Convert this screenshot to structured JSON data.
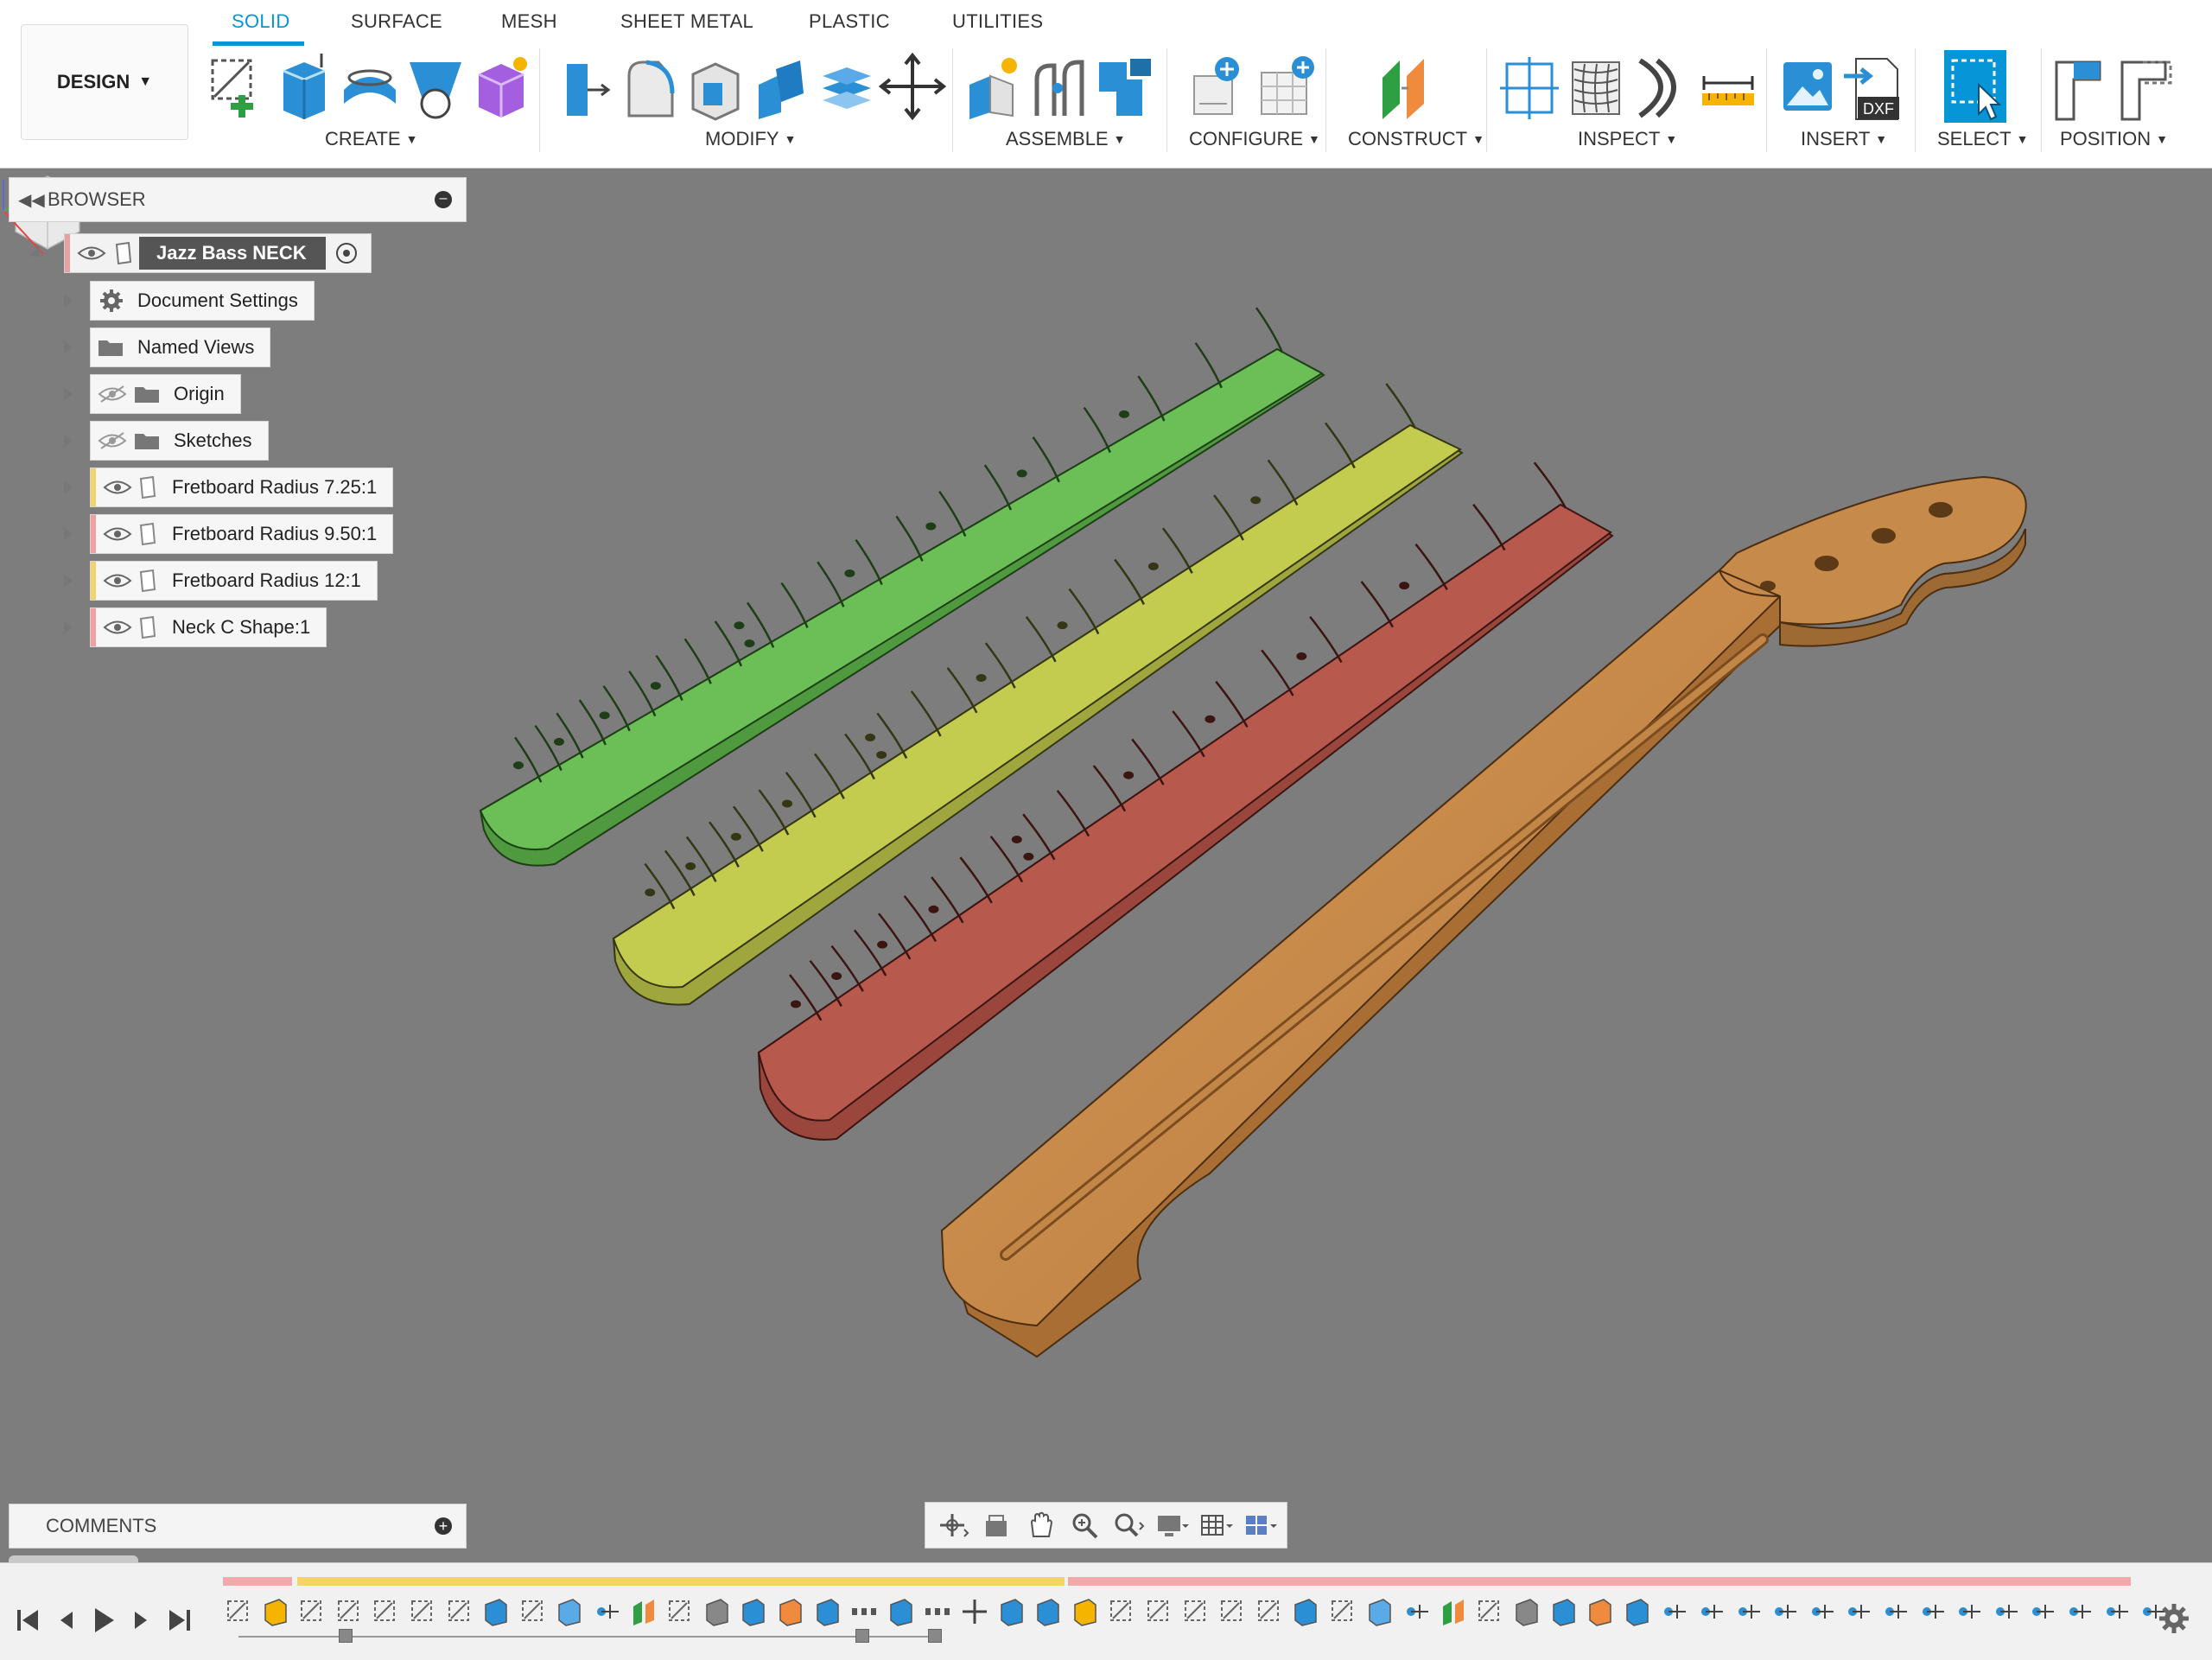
{
  "workspace": {
    "label": "DESIGN"
  },
  "tabs": [
    {
      "label": "SOLID",
      "active": true
    },
    {
      "label": "SURFACE"
    },
    {
      "label": "MESH"
    },
    {
      "label": "SHEET METAL"
    },
    {
      "label": "PLASTIC"
    },
    {
      "label": "UTILITIES"
    }
  ],
  "groups": {
    "create": "CREATE",
    "modify": "MODIFY",
    "assemble": "ASSEMBLE",
    "configure": "CONFIGURE",
    "construct": "CONSTRUCT",
    "inspect": "INSPECT",
    "insert": "INSERT",
    "select": "SELECT",
    "position": "POSITION"
  },
  "toolbar_icons": {
    "insert_dxf_badge": "DXF"
  },
  "browser": {
    "title": "BROWSER",
    "root": {
      "name": "Jazz Bass NECK"
    },
    "items": [
      {
        "label": "Document Settings",
        "icon": "gear-icon"
      },
      {
        "label": "Named Views",
        "icon": "folder-icon"
      },
      {
        "label": "Origin",
        "icon": "folder-icon",
        "visibility": "hidden"
      },
      {
        "label": "Sketches",
        "icon": "folder-icon",
        "visibility": "hidden"
      },
      {
        "label": "Fretboard Radius 7.25:1",
        "icon": "component-icon",
        "color": "#f3d36b"
      },
      {
        "label": "Fretboard Radius 9.50:1",
        "icon": "component-icon",
        "color": "#f0a0a0"
      },
      {
        "label": "Fretboard Radius 12:1",
        "icon": "component-icon",
        "color": "#f3d36b"
      },
      {
        "label": "Neck C Shape:1",
        "icon": "component-icon",
        "color": "#f0a0a0"
      }
    ]
  },
  "comments": {
    "title": "COMMENTS"
  },
  "colors": {
    "accent": "#0696d7",
    "viewport_bg": "#7d7d7d",
    "fretboard_green": "#6cbf57",
    "fretboard_yellow": "#c4cc4f",
    "fretboard_red": "#b8594e",
    "neck_wood": "#c68a4a"
  }
}
